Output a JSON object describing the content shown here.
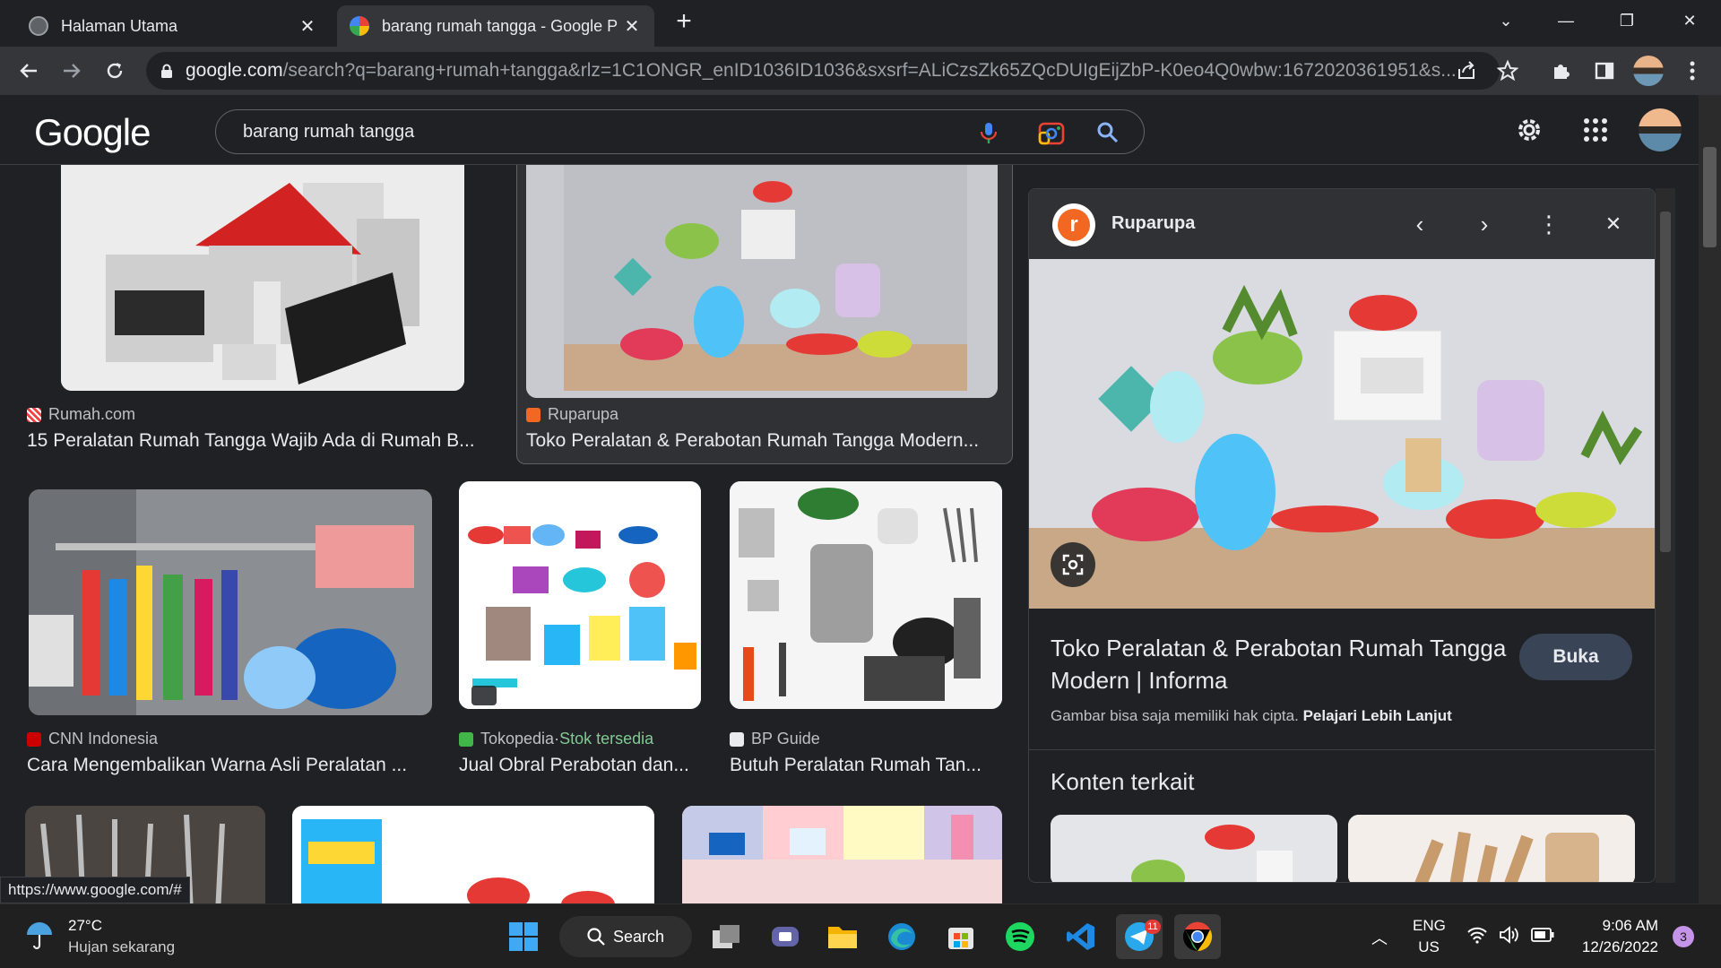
{
  "browser": {
    "tabs": [
      {
        "label": "Halaman Utama"
      },
      {
        "label": "barang rumah tangga - Google P"
      }
    ],
    "url_host": "google.com",
    "url_rest": "/search?q=barang+rumah+tangga&rlz=1C1ONGR_enID1036ID1036&sxsrf=ALiCzsZk65ZQcDUIgEijZbP-K0eo4Q0wbw:1672020361951&s..."
  },
  "google": {
    "logo": "Google",
    "query": "barang rumah tangga"
  },
  "results": [
    {
      "source": "Rumah.com",
      "title": "15 Peralatan Rumah Tangga Wajib Ada di Rumah B..."
    },
    {
      "source": "Ruparupa",
      "title": "Toko Peralatan & Perabotan Rumah Tangga Modern..."
    },
    {
      "source": "CNN Indonesia",
      "title": "Cara Mengembalikan Warna Asli Peralatan ..."
    },
    {
      "source": "Tokopedia",
      "source_sep": " · ",
      "source_extra": "Stok tersedia",
      "title": "Jual Obral Perabotan dan..."
    },
    {
      "source": "BP Guide",
      "title": "Butuh Peralatan Rumah Tan..."
    }
  ],
  "panel": {
    "source": "Ruparupa",
    "source_initial": "r",
    "title": "Toko Peralatan & Perabotan Rumah Tangga Modern | Informa",
    "open_button": "Buka",
    "copyright_text": "Gambar bisa saja memiliki hak cipta.",
    "learn_more": "Pelajari Lebih Lanjut",
    "related_heading": "Konten terkait"
  },
  "status_url": "https://www.google.com/#",
  "taskbar": {
    "weather_temp": "27°C",
    "weather_desc": "Hujan sekarang",
    "search_label": "Search",
    "lang": "ENG",
    "region": "US",
    "time": "9:06 AM",
    "date": "12/26/2022",
    "notif_count": "3",
    "telegram_badge": "11"
  },
  "colors": {
    "bg": "#202124",
    "toolbar": "#35363a",
    "accent_green": "#81c995",
    "ruparupa_orange": "#f26722"
  }
}
